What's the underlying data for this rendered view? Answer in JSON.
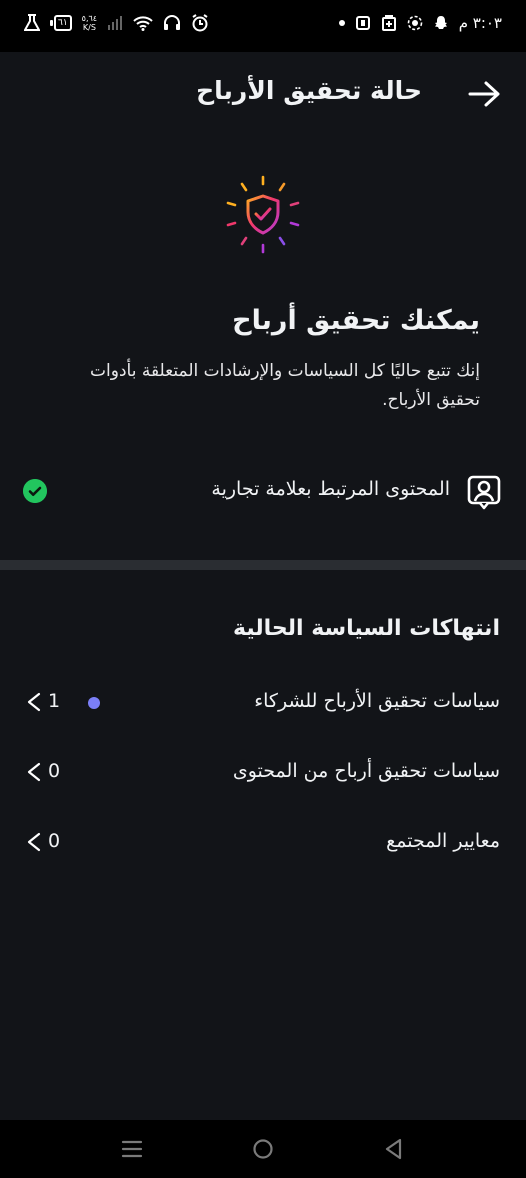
{
  "status_bar": {
    "time": "٣:٠٣ م",
    "battery": "٦١",
    "net_speed_value": "٥,٦٤",
    "net_speed_unit": "K/S"
  },
  "header": {
    "title": "حالة تحقيق الأرباح"
  },
  "eligibility": {
    "headline": "يمكنك تحقيق أرباح",
    "description": "إنك تتبع حاليًا كل السياسات والإرشادات المتعلقة بأدوات تحقيق الأرباح."
  },
  "branded_content": {
    "label": "المحتوى المرتبط بعلامة تجارية"
  },
  "violations": {
    "title": "انتهاكات السياسة الحالية",
    "items": [
      {
        "label": "سياسات تحقيق الأرباح للشركاء",
        "count": "1"
      },
      {
        "label": "سياسات تحقيق أرباح من المحتوى",
        "count": "0"
      },
      {
        "label": "معايير المجتمع",
        "count": "0"
      }
    ]
  },
  "colors": {
    "background": "#121418",
    "check": "#22c55e",
    "dot": "#7b7ff7",
    "shield_gradient": [
      "#ffb020",
      "#f0386b",
      "#b23ad8",
      "#5b6cf5"
    ]
  }
}
